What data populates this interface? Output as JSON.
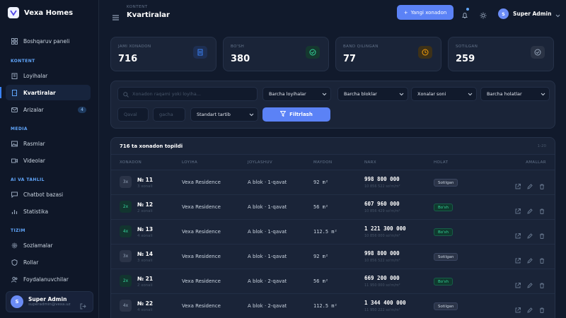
{
  "app": {
    "name": "Vexa Homes"
  },
  "sidebar": {
    "sections": [
      {
        "label": "KONTENT"
      },
      {
        "label": "MEDIA"
      },
      {
        "label": "AI VA TAHLIL"
      },
      {
        "label": "TIZIM"
      }
    ],
    "items": [
      {
        "label": "Boshqaruv paneli",
        "icon": "grid-icon"
      },
      {
        "label": "Loyihalar",
        "icon": "building-icon"
      },
      {
        "label": "Kvartiralar",
        "icon": "door-icon"
      },
      {
        "label": "Arizalar",
        "icon": "inbox-icon",
        "badge": "4"
      },
      {
        "label": "Rasmlar",
        "icon": "image-icon"
      },
      {
        "label": "Videolar",
        "icon": "video-icon"
      },
      {
        "label": "Chatbot bazasi",
        "icon": "chat-icon"
      },
      {
        "label": "Statistika",
        "icon": "chart-icon"
      },
      {
        "label": "Sozlamalar",
        "icon": "gear-icon"
      },
      {
        "label": "Rollar",
        "icon": "shield-icon"
      },
      {
        "label": "Foydalanuvchilar",
        "icon": "users-icon"
      }
    ],
    "user": {
      "initial": "S",
      "name": "Super Admin",
      "email": "superadmin@vexa.uz"
    }
  },
  "header": {
    "breadcrumb": "KONTENT",
    "title": "Kvartiralar",
    "new_button": "Yangi xonadon",
    "user_initial": "S",
    "user_name": "Super Admin"
  },
  "stats": [
    {
      "label": "JAMI XONADON",
      "value": "716",
      "icon": "building-icon",
      "color": "#3b82f6"
    },
    {
      "label": "BO'SH",
      "value": "380",
      "icon": "check-circle-icon",
      "color": "#34d399"
    },
    {
      "label": "BAND QILINGAN",
      "value": "77",
      "icon": "clock-icon",
      "color": "#f59e0b"
    },
    {
      "label": "SOTILGAN",
      "value": "259",
      "icon": "check-circle-icon",
      "color": "#94a3b8"
    }
  ],
  "filters": {
    "search_placeholder": "Xonadon raqami yoki loyiha...",
    "project": "Barcha loyihalar",
    "block": "Barcha bloklar",
    "rooms": "Xonalar soni",
    "status": "Barcha holatlar",
    "price_from": "Qaval",
    "price_to": "gacha",
    "sort": "Standart tartib",
    "filter_button": "Filtrlash"
  },
  "table": {
    "found": "716 ta xonadon topildi",
    "page_info": "1-20",
    "columns": [
      "XONADON",
      "LOYIHA",
      "JOYLASHUV",
      "MAYDON",
      "NARX",
      "HOLAT",
      "AMALLAR"
    ],
    "rows": [
      {
        "rooms": "3x",
        "no": "№ 11",
        "sub": "3 xonali",
        "project": "Vexa Residence",
        "location": "A blok · 1-qavat",
        "area": "92 m²",
        "price": "998 800 000",
        "ppm": "10 856 522 so'm/m²",
        "status": "Sotilgan"
      },
      {
        "rooms": "2x",
        "no": "№ 12",
        "sub": "2 xonali",
        "project": "Vexa Residence",
        "location": "A blok · 1-qavat",
        "area": "56 m²",
        "price": "607 960 000",
        "ppm": "10 856 429 so'm/m²",
        "status": "Bo'sh"
      },
      {
        "rooms": "4x",
        "no": "№ 13",
        "sub": "4 xonali",
        "project": "Vexa Residence",
        "location": "A blok · 1-qavat",
        "area": "112.5 m²",
        "price": "1 221 300 000",
        "ppm": "10 856 000 so'm/m²",
        "status": "Bo'sh"
      },
      {
        "rooms": "3x",
        "no": "№ 14",
        "sub": "3 xonali",
        "project": "Vexa Residence",
        "location": "A blok · 1-qavat",
        "area": "92 m²",
        "price": "998 800 000",
        "ppm": "10 856 522 so'm/m²",
        "status": "Sotilgan"
      },
      {
        "rooms": "2x",
        "no": "№ 21",
        "sub": "2 xonali",
        "project": "Vexa Residence",
        "location": "A blok · 2-qavat",
        "area": "56 m²",
        "price": "669 200 000",
        "ppm": "11 950 000 so'm/m²",
        "status": "Bo'sh"
      },
      {
        "rooms": "4x",
        "no": "№ 22",
        "sub": "4 xonali",
        "project": "Vexa Residence",
        "location": "A blok · 2-qavat",
        "area": "112.5 m²",
        "price": "1 344 400 000",
        "ppm": "11 950 222 so'm/m²",
        "status": "Sotilgan"
      }
    ]
  }
}
